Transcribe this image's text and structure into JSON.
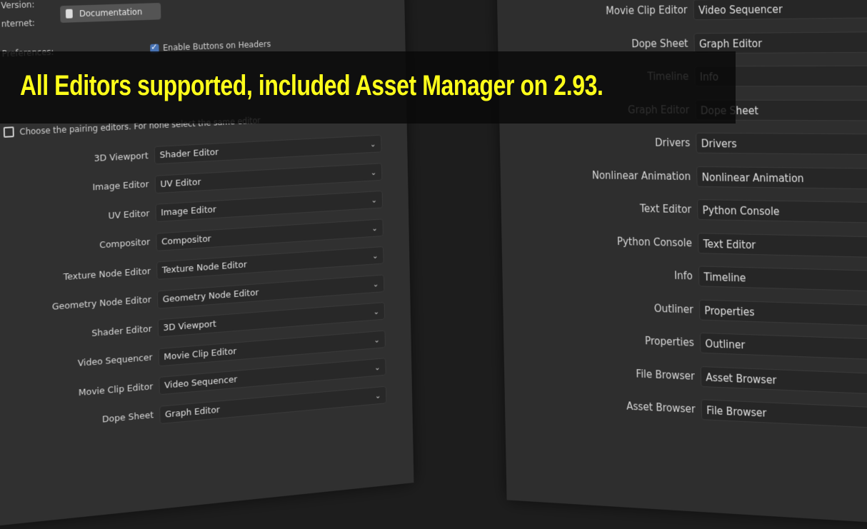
{
  "top": {
    "version_label": "Version:",
    "internet_label": "nternet:",
    "documentation_button": "Documentation",
    "preferences_label": "Preferences:",
    "enable_buttons_label": "Enable Buttons on Headers"
  },
  "hint": "Choose the pairing editors. For none select the same editor",
  "left_rows": [
    {
      "label": "3D Viewport",
      "value": "Shader Editor"
    },
    {
      "label": "Image Editor",
      "value": "UV Editor"
    },
    {
      "label": "UV Editor",
      "value": "Image Editor"
    },
    {
      "label": "Compositor",
      "value": "Compositor"
    },
    {
      "label": "Texture Node Editor",
      "value": "Texture Node Editor"
    },
    {
      "label": "Geometry Node Editor",
      "value": "Geometry Node Editor"
    },
    {
      "label": "Shader Editor",
      "value": "3D Viewport"
    },
    {
      "label": "Video Sequencer",
      "value": "Movie Clip Editor"
    },
    {
      "label": "Movie Clip Editor",
      "value": "Video Sequencer"
    },
    {
      "label": "Dope Sheet",
      "value": "Graph Editor"
    }
  ],
  "right_rows": [
    {
      "label": "Movie Clip Editor",
      "value": "Video Sequencer"
    },
    {
      "label": "Dope Sheet",
      "value": "Graph Editor"
    },
    {
      "label": "Timeline",
      "value": "Info"
    },
    {
      "label": "Graph Editor",
      "value": "Dope Sheet"
    },
    {
      "label": "Drivers",
      "value": "Drivers"
    },
    {
      "label": "Nonlinear Animation",
      "value": "Nonlinear Animation"
    },
    {
      "label": "Text Editor",
      "value": "Python Console"
    },
    {
      "label": "Python Console",
      "value": "Text Editor"
    },
    {
      "label": "Info",
      "value": "Timeline"
    },
    {
      "label": "Outliner",
      "value": "Properties"
    },
    {
      "label": "Properties",
      "value": "Outliner"
    },
    {
      "label": "File Browser",
      "value": "Asset Browser"
    },
    {
      "label": "Asset Browser",
      "value": "File Browser"
    }
  ],
  "banner": "All Editors supported, included Asset Manager on 2.93.",
  "colors": {
    "banner_text": "#ffff1a",
    "checkbox": "#4772b3"
  },
  "icons": {
    "chevron": "chevron-down-icon",
    "documentation": "book-icon",
    "hint": "window-icon"
  }
}
